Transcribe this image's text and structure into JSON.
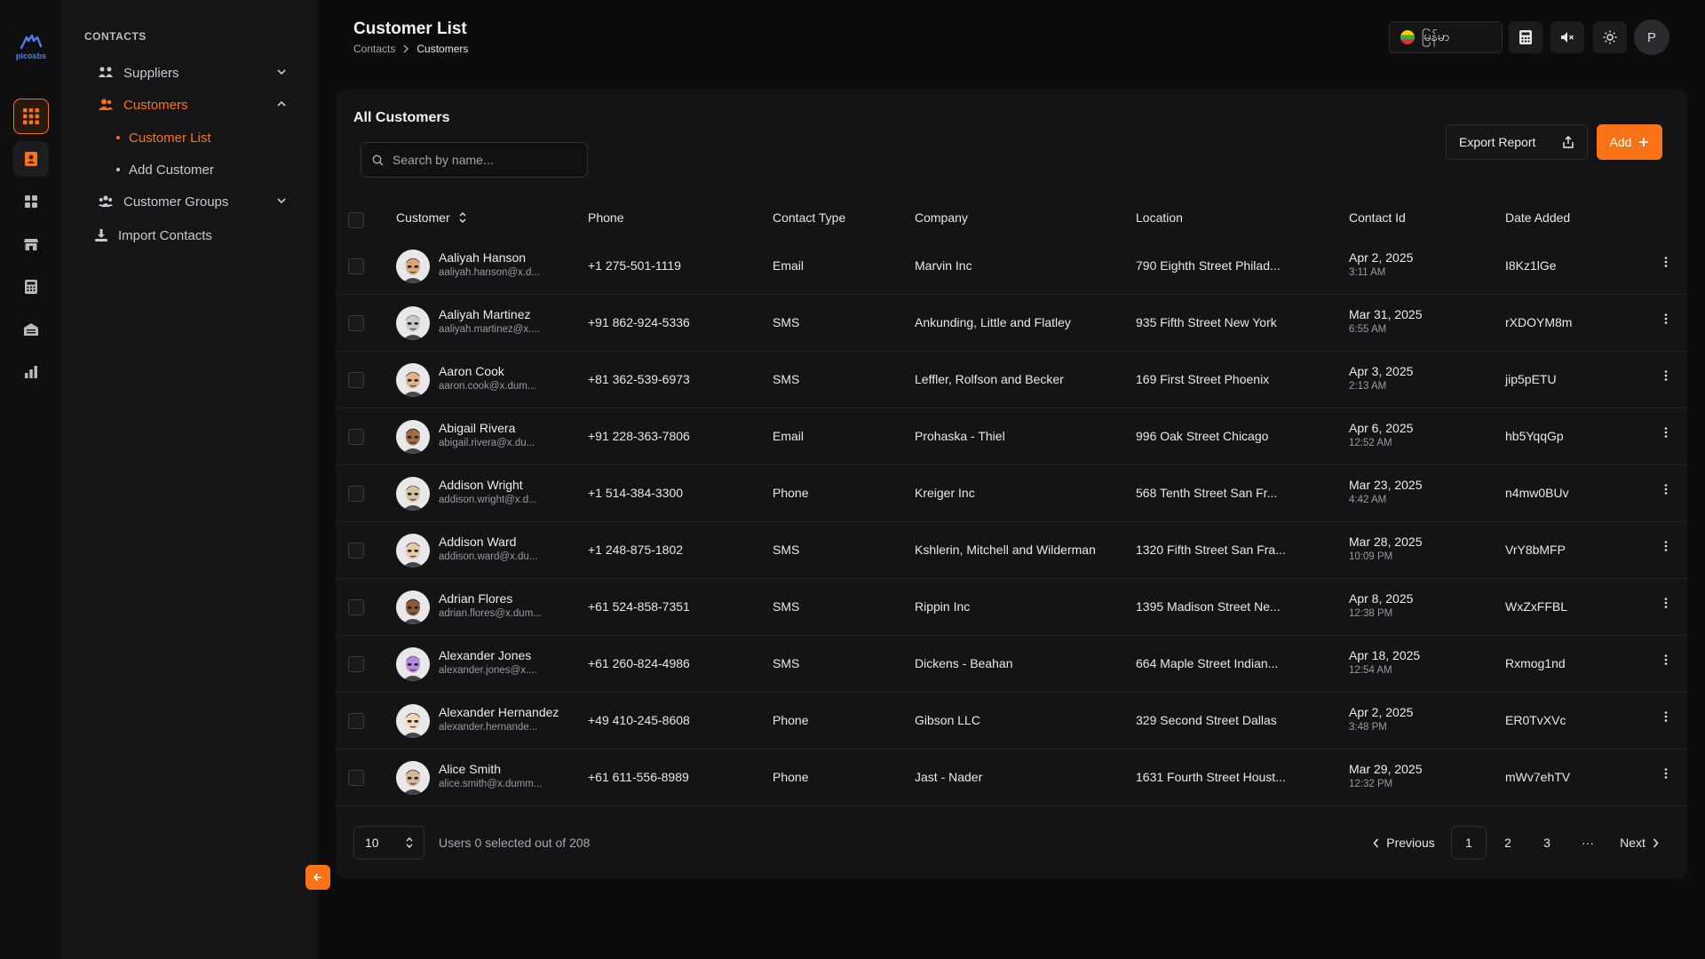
{
  "app": {
    "logo_text": "picosbs"
  },
  "rail": {
    "items": [
      {
        "icon": "apps-grid-icon",
        "active": "main"
      },
      {
        "icon": "contact-book-icon",
        "active": "sub"
      },
      {
        "icon": "widgets-icon"
      },
      {
        "icon": "store-icon"
      },
      {
        "icon": "calculator-icon"
      },
      {
        "icon": "warehouse-icon"
      },
      {
        "icon": "bar-chart-icon"
      }
    ]
  },
  "sidebar": {
    "section_title": "CONTACTS",
    "items": [
      {
        "label": "Suppliers",
        "icon": "suppliers-icon",
        "expanded": false
      },
      {
        "label": "Customers",
        "icon": "customers-icon",
        "expanded": true
      },
      {
        "label": "Customer Groups",
        "icon": "customer-groups-icon",
        "expanded": false
      },
      {
        "label": "Import Contacts",
        "icon": "download-icon"
      }
    ],
    "sub_items": [
      {
        "label": "Customer List",
        "active": true
      },
      {
        "label": "Add Customer",
        "active": false
      }
    ]
  },
  "header": {
    "title": "Customer List",
    "breadcrumb": [
      "Contacts",
      "Customers"
    ],
    "language": "မြန်မာ",
    "avatar_initial": "P"
  },
  "card": {
    "title": "All Customers",
    "search_placeholder": "Search by name...",
    "export_label": "Export Report",
    "add_label": "Add"
  },
  "table": {
    "columns": [
      "Customer",
      "Phone",
      "Contact Type",
      "Company",
      "Location",
      "Contact Id",
      "Date Added"
    ],
    "rows": [
      {
        "name": "Aaliyah Hanson",
        "email": "aaliyah.hanson@x.d...",
        "phone": "+1 275-501-1119",
        "type": "Email",
        "company": "Marvin Inc",
        "location": "790 Eighth Street Philad...",
        "date": "Apr 2, 2025",
        "time": "3:11 AM",
        "id": "I8Kz1lGe"
      },
      {
        "name": "Aaliyah Martinez",
        "email": "aaliyah.martinez@x....",
        "phone": "+91 862-924-5336",
        "type": "SMS",
        "company": "Ankunding, Little and Flatley",
        "location": "935 Fifth Street New York",
        "date": "Mar 31, 2025",
        "time": "6:55 AM",
        "id": "rXDOYM8m"
      },
      {
        "name": "Aaron Cook",
        "email": "aaron.cook@x.dum...",
        "phone": "+81 362-539-6973",
        "type": "SMS",
        "company": "Leffler, Rolfson and Becker",
        "location": "169 First Street Phoenix",
        "date": "Apr 3, 2025",
        "time": "2:13 AM",
        "id": "jip5pETU"
      },
      {
        "name": "Abigail Rivera",
        "email": "abigail.rivera@x.du...",
        "phone": "+91 228-363-7806",
        "type": "Email",
        "company": "Prohaska - Thiel",
        "location": "996 Oak Street Chicago",
        "date": "Apr 6, 2025",
        "time": "12:52 AM",
        "id": "hb5YqqGp"
      },
      {
        "name": "Addison Wright",
        "email": "addison.wright@x.d...",
        "phone": "+1 514-384-3300",
        "type": "Phone",
        "company": "Kreiger Inc",
        "location": "568 Tenth Street San Fr...",
        "date": "Mar 23, 2025",
        "time": "4:42 AM",
        "id": "n4mw0BUv"
      },
      {
        "name": "Addison Ward",
        "email": "addison.ward@x.du...",
        "phone": "+1 248-875-1802",
        "type": "SMS",
        "company": "Kshlerin, Mitchell and Wilderman",
        "location": "1320 Fifth Street San Fra...",
        "date": "Mar 28, 2025",
        "time": "10:09 PM",
        "id": "VrY8bMFP"
      },
      {
        "name": "Adrian Flores",
        "email": "adrian.flores@x.dum...",
        "phone": "+61 524-858-7351",
        "type": "SMS",
        "company": "Rippin Inc",
        "location": "1395 Madison Street Ne...",
        "date": "Apr 8, 2025",
        "time": "12:38 PM",
        "id": "WxZxFFBL"
      },
      {
        "name": "Alexander Jones",
        "email": "alexander.jones@x....",
        "phone": "+61 260-824-4986",
        "type": "SMS",
        "company": "Dickens - Beahan",
        "location": "664 Maple Street Indian...",
        "date": "Apr 18, 2025",
        "time": "12:54 AM",
        "id": "Rxmog1nd"
      },
      {
        "name": "Alexander Hernandez",
        "email": "alexander.hernande...",
        "phone": "+49 410-245-8608",
        "type": "Phone",
        "company": "Gibson LLC",
        "location": "329 Second Street Dallas",
        "date": "Apr 2, 2025",
        "time": "3:48 PM",
        "id": "ER0TvXVc"
      },
      {
        "name": "Alice Smith",
        "email": "alice.smith@x.dumm...",
        "phone": "+61 611-556-8989",
        "type": "Phone",
        "company": "Jast - Nader",
        "location": "1631 Fourth Street Houst...",
        "date": "Mar 29, 2025",
        "time": "12:32 PM",
        "id": "mWv7ehTV"
      }
    ]
  },
  "footer": {
    "page_size": "10",
    "selection_info": "Users 0 selected out of 208",
    "prev_label": "Previous",
    "next_label": "Next",
    "pages": [
      "1",
      "2",
      "3"
    ],
    "ellipsis": "···",
    "current_page": "1"
  },
  "colors": {
    "accent": "#f97316",
    "background": "#0c0c0d",
    "card": "#141416"
  }
}
